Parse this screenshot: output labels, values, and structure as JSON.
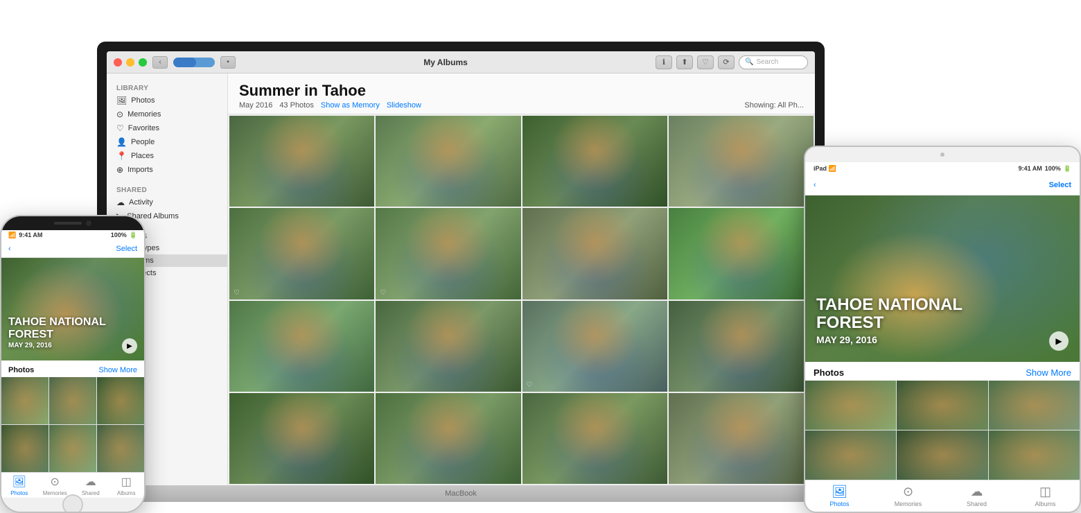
{
  "macbook": {
    "label": "MacBook",
    "title": "My Albums",
    "album": {
      "title": "Summer in Tahoe",
      "date": "May 2016",
      "count": "43 Photos",
      "show_as_memory": "Show as Memory",
      "slideshow": "Slideshow",
      "showing": "Showing: All Ph..."
    },
    "sidebar": {
      "library_label": "Library",
      "items": [
        {
          "label": "Photos",
          "icon": "🖼"
        },
        {
          "label": "Memories",
          "icon": "⊙"
        },
        {
          "label": "Favorites",
          "icon": "♡"
        },
        {
          "label": "People",
          "icon": "👤"
        },
        {
          "label": "Places",
          "icon": "📍"
        },
        {
          "label": "Imports",
          "icon": "⊕"
        }
      ],
      "shared_label": "Shared",
      "shared_items": [
        {
          "label": "Activity",
          "icon": "☁"
        },
        {
          "label": "Shared Albums",
          "icon": "▶"
        }
      ],
      "albums_label": "Albums",
      "album_items": [
        {
          "label": "Media Types",
          "icon": ""
        },
        {
          "label": "My Albums",
          "icon": ""
        },
        {
          "label": "My Projects",
          "icon": ""
        }
      ]
    },
    "search_placeholder": "Search"
  },
  "iphone": {
    "status": {
      "carrier": "9:41 AM",
      "battery": "100%"
    },
    "nav": {
      "back": "‹",
      "select": "Select"
    },
    "hero": {
      "title": "TAHOE NATIONAL\nFOREST",
      "date": "MAY 29, 2016"
    },
    "section": {
      "label": "Photos",
      "more": "Show More"
    },
    "tabs": [
      {
        "label": "Photos",
        "icon": "🖼",
        "active": true
      },
      {
        "label": "Memories",
        "icon": "⊙",
        "active": false
      },
      {
        "label": "Shared",
        "icon": "☁",
        "active": false
      },
      {
        "label": "Albums",
        "icon": "◫",
        "active": false
      }
    ]
  },
  "ipad": {
    "status": {
      "carrier": "iPad",
      "signal": "WiFi",
      "time": "9:41 AM",
      "battery": "100%"
    },
    "nav": {
      "back": "‹",
      "select": "Select"
    },
    "hero": {
      "title": "TAHOE NATIONAL\nFOREST",
      "date": "MAY 29, 2016"
    },
    "section": {
      "label": "Photos",
      "more": "Show More"
    },
    "tabs": [
      {
        "label": "Photos",
        "icon": "🖼",
        "active": true
      },
      {
        "label": "Memories",
        "icon": "⊙",
        "active": false
      },
      {
        "label": "Shared",
        "icon": "☁",
        "active": false
      },
      {
        "label": "Albums",
        "icon": "◫",
        "active": false
      }
    ]
  }
}
